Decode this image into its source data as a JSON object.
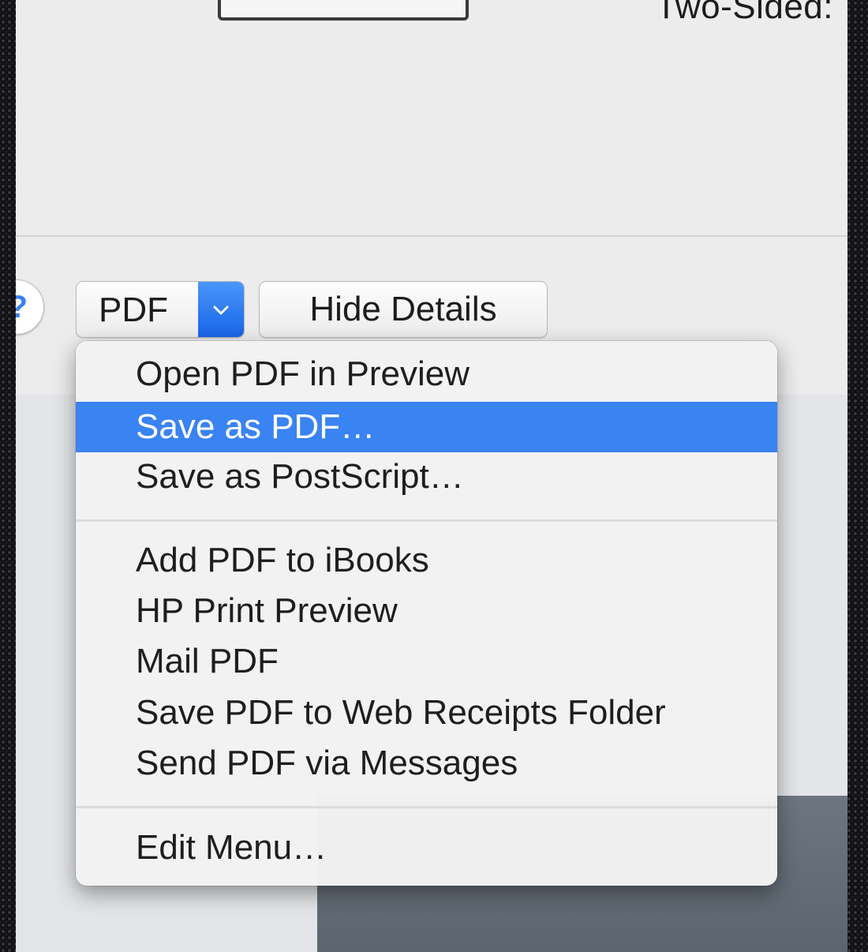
{
  "dialog": {
    "two_sided_label": "Two-Sided:"
  },
  "toolbar": {
    "help_glyph": "?",
    "pdf_label": "PDF",
    "hide_details_label": "Hide Details"
  },
  "menu": {
    "items": [
      {
        "label": "Open PDF in Preview",
        "selected": false
      },
      {
        "label": "Save as PDF…",
        "selected": true
      },
      {
        "label": "Save as PostScript…",
        "selected": false
      },
      {
        "label": "Add PDF to iBooks",
        "selected": false
      },
      {
        "label": "HP Print Preview",
        "selected": false
      },
      {
        "label": "Mail PDF",
        "selected": false
      },
      {
        "label": "Save PDF to Web Receipts Folder",
        "selected": false
      },
      {
        "label": "Send PDF via Messages",
        "selected": false
      },
      {
        "label": "Edit Menu…",
        "selected": false
      }
    ]
  },
  "colors": {
    "selection": "#3a83f3",
    "accent_blue": "#1764e8",
    "dialog_background": "#ececec"
  },
  "icons": {
    "help": "help-icon",
    "dropdown": "chevron-down-icon"
  }
}
